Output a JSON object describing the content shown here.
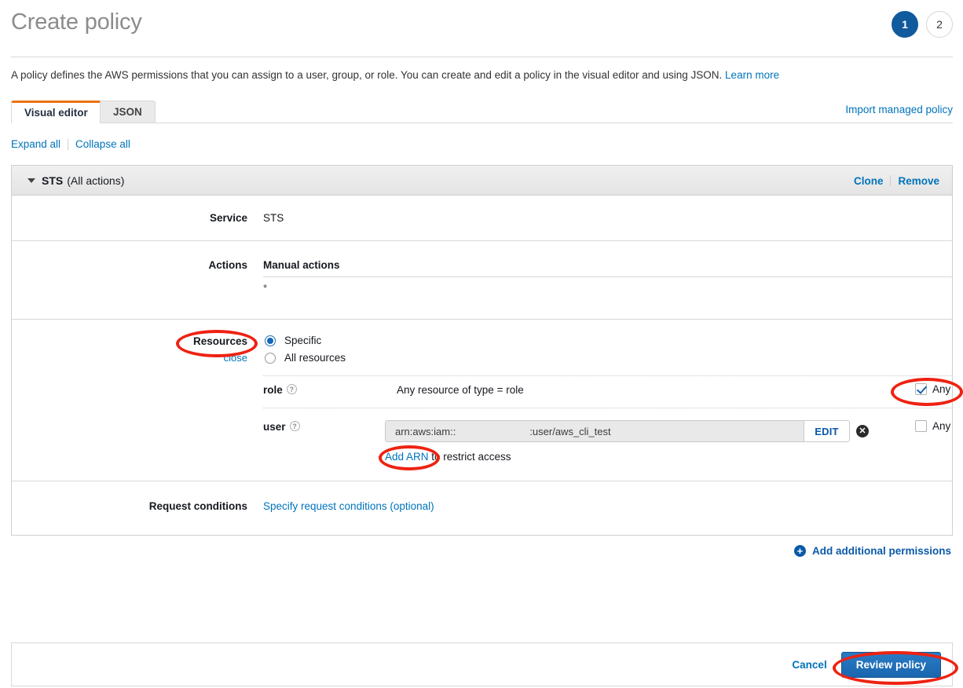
{
  "header": {
    "title": "Create policy",
    "steps": [
      {
        "label": "1",
        "state": "active"
      },
      {
        "label": "2",
        "state": "inactive"
      }
    ],
    "intro_text": "A policy defines the AWS permissions that you can assign to a user, group, or role. You can create and edit a policy in the visual editor and using JSON.",
    "intro_link": "Learn more"
  },
  "tabs": {
    "visual_editor": "Visual editor",
    "json": "JSON",
    "import_managed_policy": "Import managed policy",
    "selected": "Visual editor"
  },
  "toolbar": {
    "expand_all": "Expand all",
    "collapse_all": "Collapse all"
  },
  "permission_block": {
    "service_name": "STS",
    "service_qualifier": "(All actions)",
    "clone_label": "Clone",
    "remove_label": "Remove",
    "service": {
      "label": "Service",
      "value": "STS"
    },
    "actions": {
      "label": "Actions",
      "heading": "Manual actions",
      "value": "*"
    },
    "resources": {
      "label": "Resources",
      "close_link": "close",
      "scope_options": [
        {
          "label": "Specific",
          "selected": true
        },
        {
          "label": "All resources",
          "selected": false
        }
      ],
      "rows": [
        {
          "key": "role",
          "help_glyph": "?",
          "value_text": "Any resource of type = role",
          "any_label": "Any",
          "any_checked": true
        },
        {
          "key": "user",
          "help_glyph": "?",
          "arn_prefix": "arn:aws:iam::",
          "arn_suffix": ":user/aws_cli_test",
          "edit_label": "EDIT",
          "remove_glyph": "✕",
          "add_arn_link": "Add ARN",
          "add_arn_rest": " to restrict access",
          "any_label": "Any",
          "any_checked": false
        }
      ]
    },
    "request_conditions": {
      "label": "Request conditions",
      "link": "Specify request conditions (optional)"
    }
  },
  "add_additional_permissions": {
    "label": "Add additional permissions",
    "icon_glyph": "+"
  },
  "footer": {
    "cancel_label": "Cancel",
    "review_policy_label": "Review policy"
  },
  "colors": {
    "accent_orange": "#ec7211",
    "link_blue": "#0073bb",
    "primary_button": "#1a66b0",
    "annotation_red": "#ee2211",
    "step_active": "#125a9e"
  },
  "annotations": [
    {
      "name": "resources-label-circle"
    },
    {
      "name": "role-any-checkbox-circle"
    },
    {
      "name": "add-arn-circle"
    },
    {
      "name": "review-policy-circle"
    }
  ]
}
